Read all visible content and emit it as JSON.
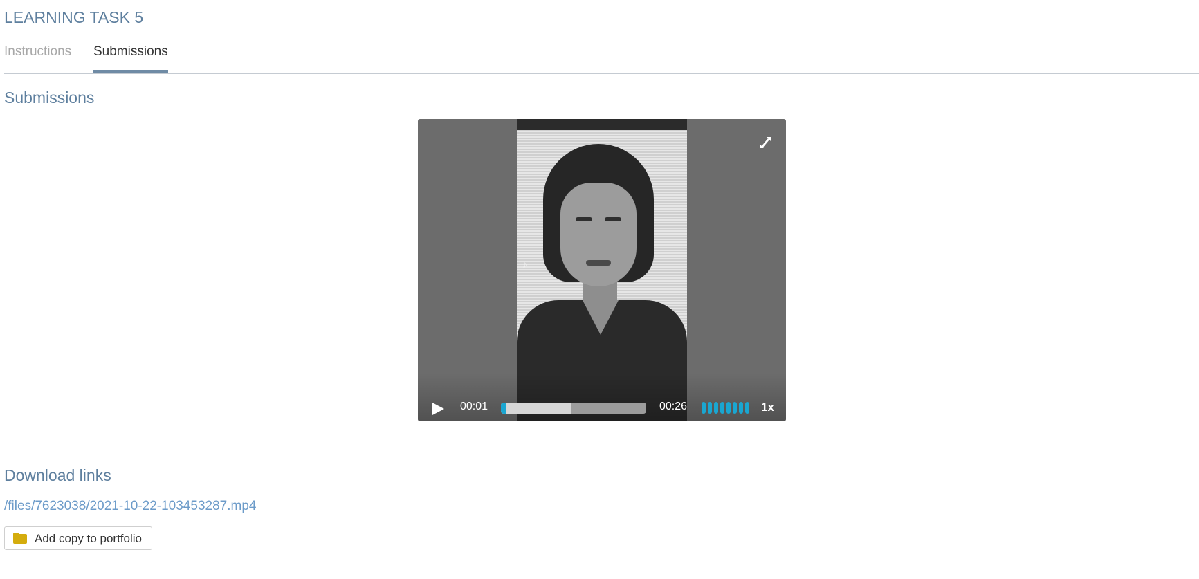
{
  "header": {
    "title": "LEARNING TASK 5"
  },
  "tabs": [
    {
      "label": "Instructions",
      "active": false
    },
    {
      "label": "Submissions",
      "active": true
    }
  ],
  "submissions": {
    "title": "Submissions",
    "video": {
      "current_time": "00:01",
      "duration": "00:26",
      "played_fraction": 0.04,
      "buffered_fraction": 0.48,
      "volume_fraction": 1.0,
      "speed": "1x",
      "watermark_icon": "tiktok-icon"
    }
  },
  "downloads": {
    "title": "Download links",
    "link": "/files/7623038/2021-10-22-103453287.mp4",
    "add_to_portfolio_label": "Add copy to portfolio",
    "folder_icon_color": "#d4ac0d"
  },
  "colors": {
    "heading": "#5e7f9e",
    "link": "#6c9bc9",
    "accent": "#1aa6d1"
  }
}
